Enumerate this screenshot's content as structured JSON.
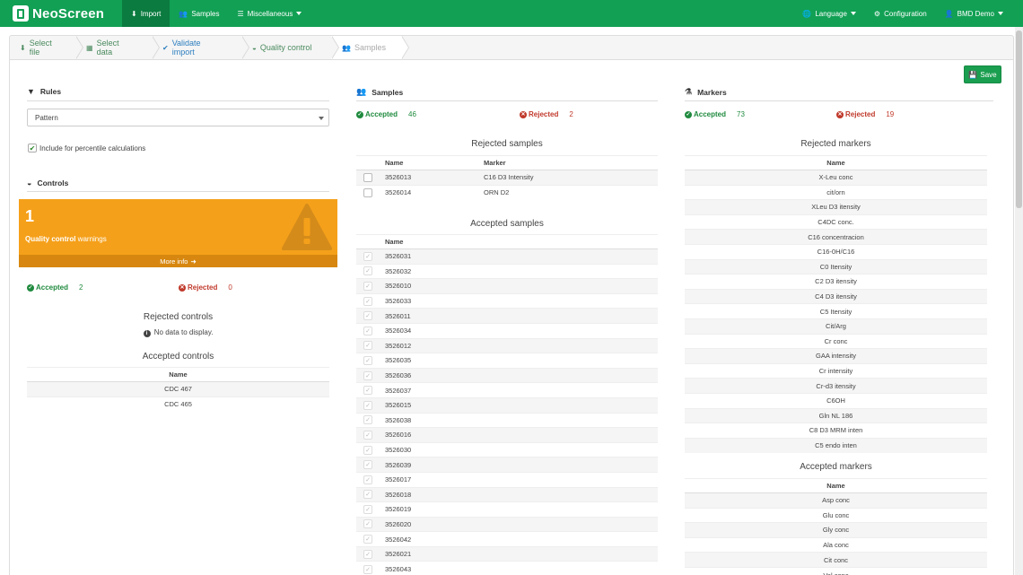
{
  "navbar": {
    "brand": "NeoScreen",
    "items": [
      {
        "label": "Import",
        "icon": "download-icon",
        "active": true
      },
      {
        "label": "Samples",
        "icon": "users-icon"
      },
      {
        "label": "Miscellaneous",
        "icon": "sliders-icon",
        "dropdown": true
      }
    ],
    "right": [
      {
        "label": "Language",
        "icon": "globe-icon",
        "dropdown": true
      },
      {
        "label": "Configuration",
        "icon": "cogs-icon"
      },
      {
        "label": "BMD Demo",
        "icon": "user-icon",
        "dropdown": true
      }
    ]
  },
  "steps": [
    {
      "label": "Select file",
      "icon": "download-icon"
    },
    {
      "label": "Select data",
      "icon": "table-icon"
    },
    {
      "label": "Validate import",
      "icon": "check-circle-icon"
    },
    {
      "label": "Quality control",
      "icon": "dashboard-icon"
    },
    {
      "label": "Samples",
      "icon": "users-icon"
    }
  ],
  "save_label": "Save",
  "rules": {
    "title": "Rules",
    "select_value": "Pattern",
    "checkbox_label": "Include for percentile calculations"
  },
  "controls": {
    "title": "Controls",
    "warning_count": "1",
    "warning_label_bold": "Quality control",
    "warning_label_rest": " warnings",
    "more_info": "More info",
    "accepted_label": "Accepted",
    "accepted_count": "2",
    "rejected_label": "Rejected",
    "rejected_count": "0",
    "rejected_title": "Rejected controls",
    "no_data": "No data to display.",
    "accepted_title": "Accepted controls",
    "column_name": "Name",
    "accepted_rows": [
      "CDC 467",
      "CDC 465"
    ]
  },
  "samples": {
    "title": "Samples",
    "accepted_label": "Accepted",
    "accepted_count": "46",
    "rejected_label": "Rejected",
    "rejected_count": "2",
    "rejected_title": "Rejected samples",
    "col_name": "Name",
    "col_marker": "Marker",
    "rejected_rows": [
      {
        "name": "3526013",
        "marker": "C16 D3 Intensity"
      },
      {
        "name": "3526014",
        "marker": "ORN D2"
      }
    ],
    "accepted_title": "Accepted samples",
    "accepted_rows": [
      "3526031",
      "3526032",
      "3526010",
      "3526033",
      "3526011",
      "3526034",
      "3526012",
      "3526035",
      "3526036",
      "3526037",
      "3526015",
      "3526038",
      "3526016",
      "3526030",
      "3526039",
      "3526017",
      "3526018",
      "3526019",
      "3526020",
      "3526042",
      "3526021",
      "3526043"
    ]
  },
  "markers": {
    "title": "Markers",
    "accepted_label": "Accepted",
    "accepted_count": "73",
    "rejected_label": "Rejected",
    "rejected_count": "19",
    "rejected_title": "Rejected markers",
    "col_name": "Name",
    "rejected_rows": [
      "X-Leu conc",
      "cit/orn",
      "XLeu D3 itensity",
      "C4DC conc.",
      "C16 concentracion",
      "C16-0H/C16",
      "C0 Itensity",
      "C2 D3 itensity",
      "C4 D3 itensity",
      "C5 Itensity",
      "Cit/Arg",
      "Cr conc",
      "GAA intensity",
      "Cr intensity",
      "Cr-d3 itensity",
      "C6OH",
      "Gln NL 186",
      "C8 D3 MRM inten",
      "C5 endo inten"
    ],
    "accepted_title": "Accepted markers",
    "accepted_rows": [
      "Asp conc",
      "Glu conc",
      "Gly conc",
      "Ala conc",
      "Cit conc",
      "Val conc"
    ]
  }
}
